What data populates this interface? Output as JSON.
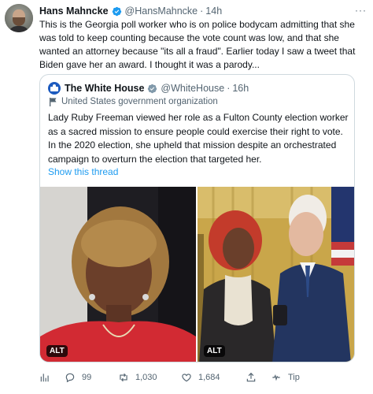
{
  "author": {
    "name": "Hans Mahncke",
    "handle": "@HansMahncke",
    "separator": "·",
    "time": "14h"
  },
  "tweet_text": "This is the Georgia poll worker who is on police bodycam admitting that she was told to keep counting because the vote count was low, and that she wanted an attorney because \"its all a fraud\". Earlier today I saw a tweet that Biden gave her an award. I thought it was a parody...",
  "quoted": {
    "name": "The White House",
    "handle": "@WhiteHouse",
    "separator": "·",
    "time": "16h",
    "org_label": "United States government organization",
    "text": "Lady Ruby Freeman viewed her role as a Fulton County election worker as a sacred mission to ensure people could exercise their right to vote. In the 2020 election, she upheld that mission despite an orchestrated campaign to overturn the election that targeted her.",
    "show_thread": "Show this thread",
    "media": [
      {
        "alt_badge": "ALT",
        "icon": "photo-portrait"
      },
      {
        "alt_badge": "ALT",
        "icon": "photo-award-ceremony"
      }
    ]
  },
  "actions": {
    "replies": "99",
    "retweets": "1,030",
    "likes": "1,684",
    "tip": "Tip"
  },
  "colors": {
    "accent": "#1d9bf0",
    "muted": "#536471",
    "border": "#cfd9de"
  }
}
